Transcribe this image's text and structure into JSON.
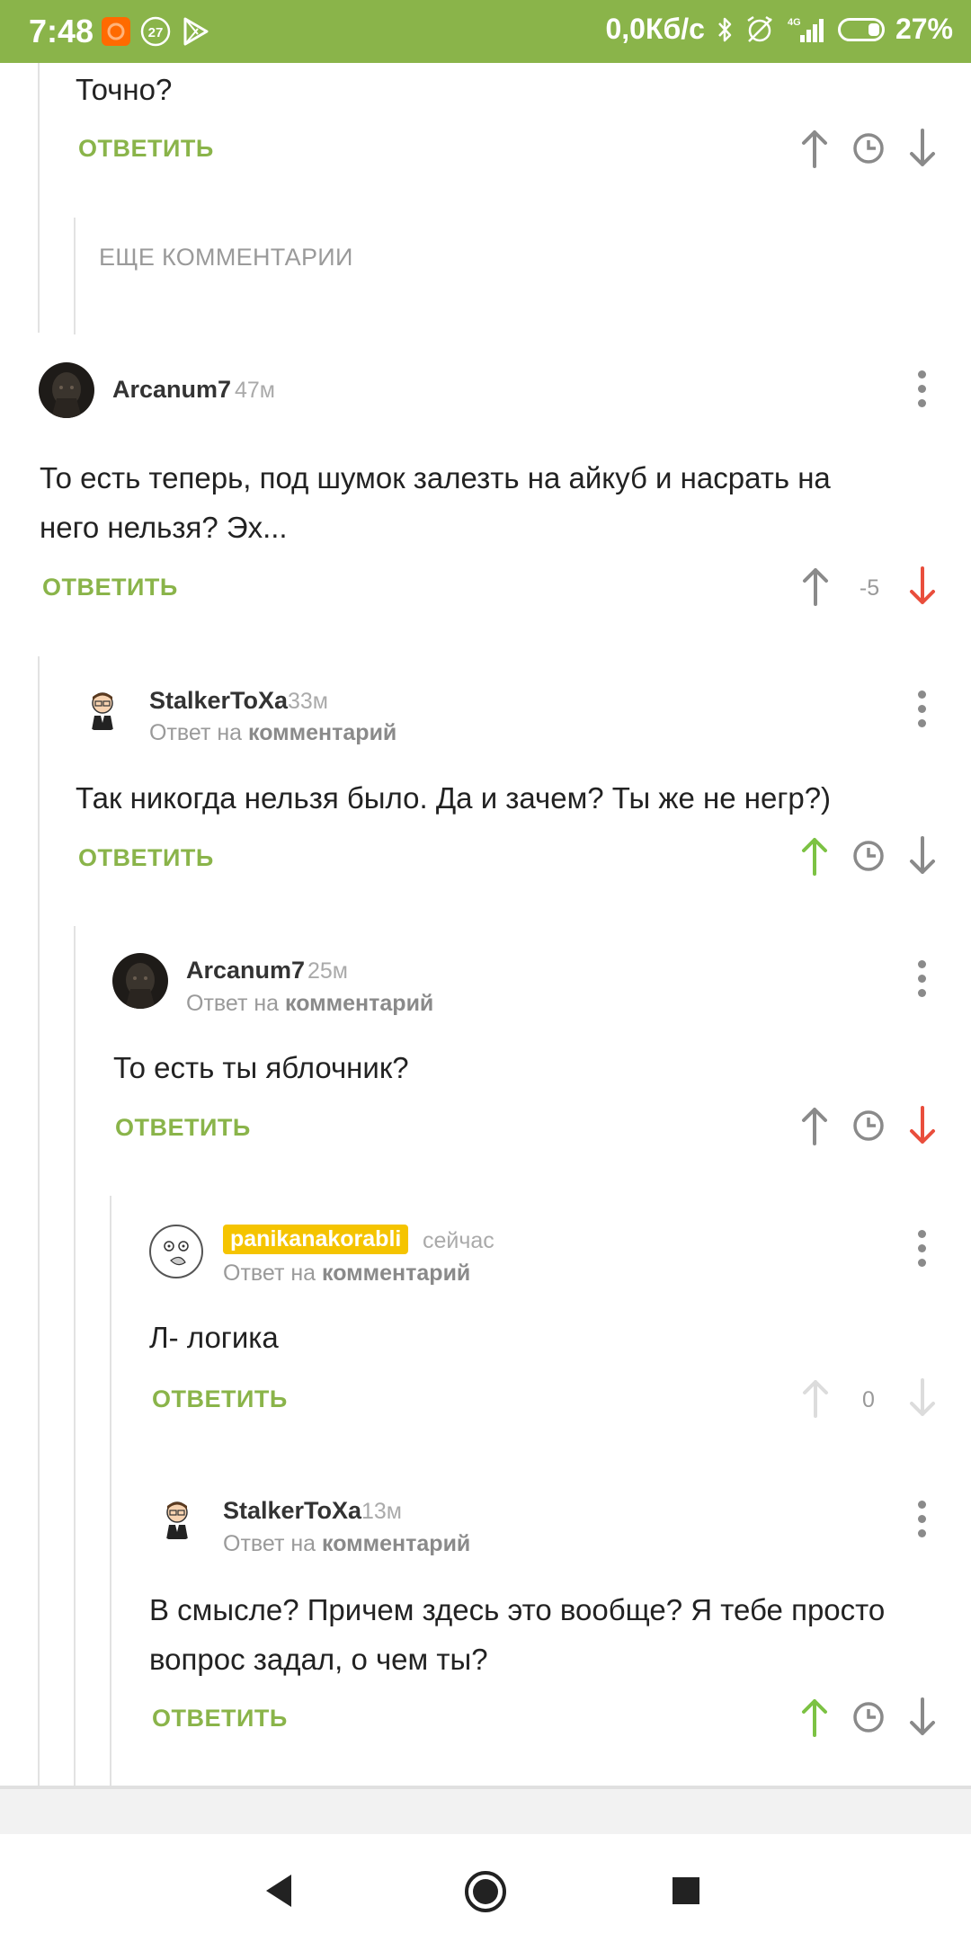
{
  "status_bar": {
    "time": "7:48",
    "notif_badge": "27",
    "net_speed": "0,0Кб/с",
    "network": "4G",
    "battery": "27%"
  },
  "comments": {
    "c0": {
      "text": "Точно?",
      "reply": "ОТВЕТИТЬ"
    },
    "more": "ЕЩЕ КОММЕНТАРИИ",
    "c1": {
      "author": "Arcanum7",
      "time": "47м",
      "text_line1": "То есть теперь, под шумок залезть на айкуб и насрать на",
      "text_line2": "него нельзя? Эх...",
      "reply": "ОТВЕТИТЬ",
      "score": "-5"
    },
    "c2": {
      "author": "StalkerToXa",
      "time": "33м",
      "replyto_prefix": "Ответ на",
      "replyto_link": "комментарий",
      "text": "Так никогда нельзя было. Да и зачем? Ты же не негр?)",
      "reply": "ОТВЕТИТЬ"
    },
    "c3": {
      "author": "Arcanum7",
      "time": "25м",
      "replyto_prefix": "Ответ на",
      "replyto_link": "комментарий",
      "text": "То есть ты яблочник?",
      "reply": "ОТВЕТИТЬ"
    },
    "c4": {
      "author": "panikanakorabli",
      "time": "сейчас",
      "replyto_prefix": "Ответ на",
      "replyto_link": "комментарий",
      "text": "Л- логика",
      "reply": "ОТВЕТИТЬ",
      "score": "0"
    },
    "c5": {
      "author": "StalkerToXa",
      "time": "13м",
      "replyto_prefix": "Ответ на",
      "replyto_link": "комментарий",
      "text_line1": "В смысле? Причем здесь это вообще? Я тебе просто",
      "text_line2": "вопрос задал, о чем ты?",
      "reply": "ОТВЕТИТЬ"
    }
  },
  "colors": {
    "brand": "#8ab44a",
    "down_active": "#e94e3c",
    "up_active": "#7cc243",
    "inactive": "#8a8a8a",
    "disabled": "#dcdcdc"
  }
}
